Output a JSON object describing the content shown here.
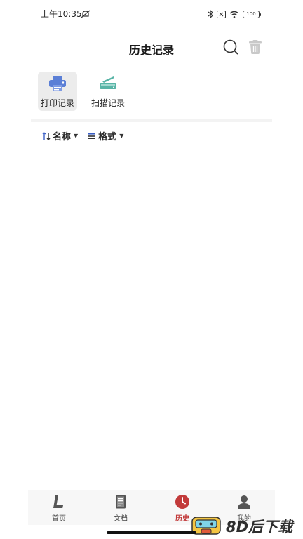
{
  "status_bar": {
    "time": "上午10:35",
    "battery": "100"
  },
  "header": {
    "title": "历史记录"
  },
  "record_tabs": [
    {
      "label": "打印记录",
      "icon": "printer-icon",
      "active": true
    },
    {
      "label": "扫描记录",
      "icon": "scanner-icon",
      "active": false
    }
  ],
  "filters": {
    "name_label": "名称",
    "format_label": "格式"
  },
  "bottom_nav": [
    {
      "label": "首页",
      "icon": "home-icon",
      "active": false
    },
    {
      "label": "文档",
      "icon": "document-icon",
      "active": false
    },
    {
      "label": "历史",
      "icon": "clock-icon",
      "active": true
    },
    {
      "label": "我的",
      "icon": "user-icon",
      "active": false
    }
  ],
  "watermark": {
    "text": "8D后下载"
  },
  "colors": {
    "accent": "#c23a3a",
    "printer_blue": "#5b7fd6",
    "scanner_teal": "#58b4a6"
  }
}
